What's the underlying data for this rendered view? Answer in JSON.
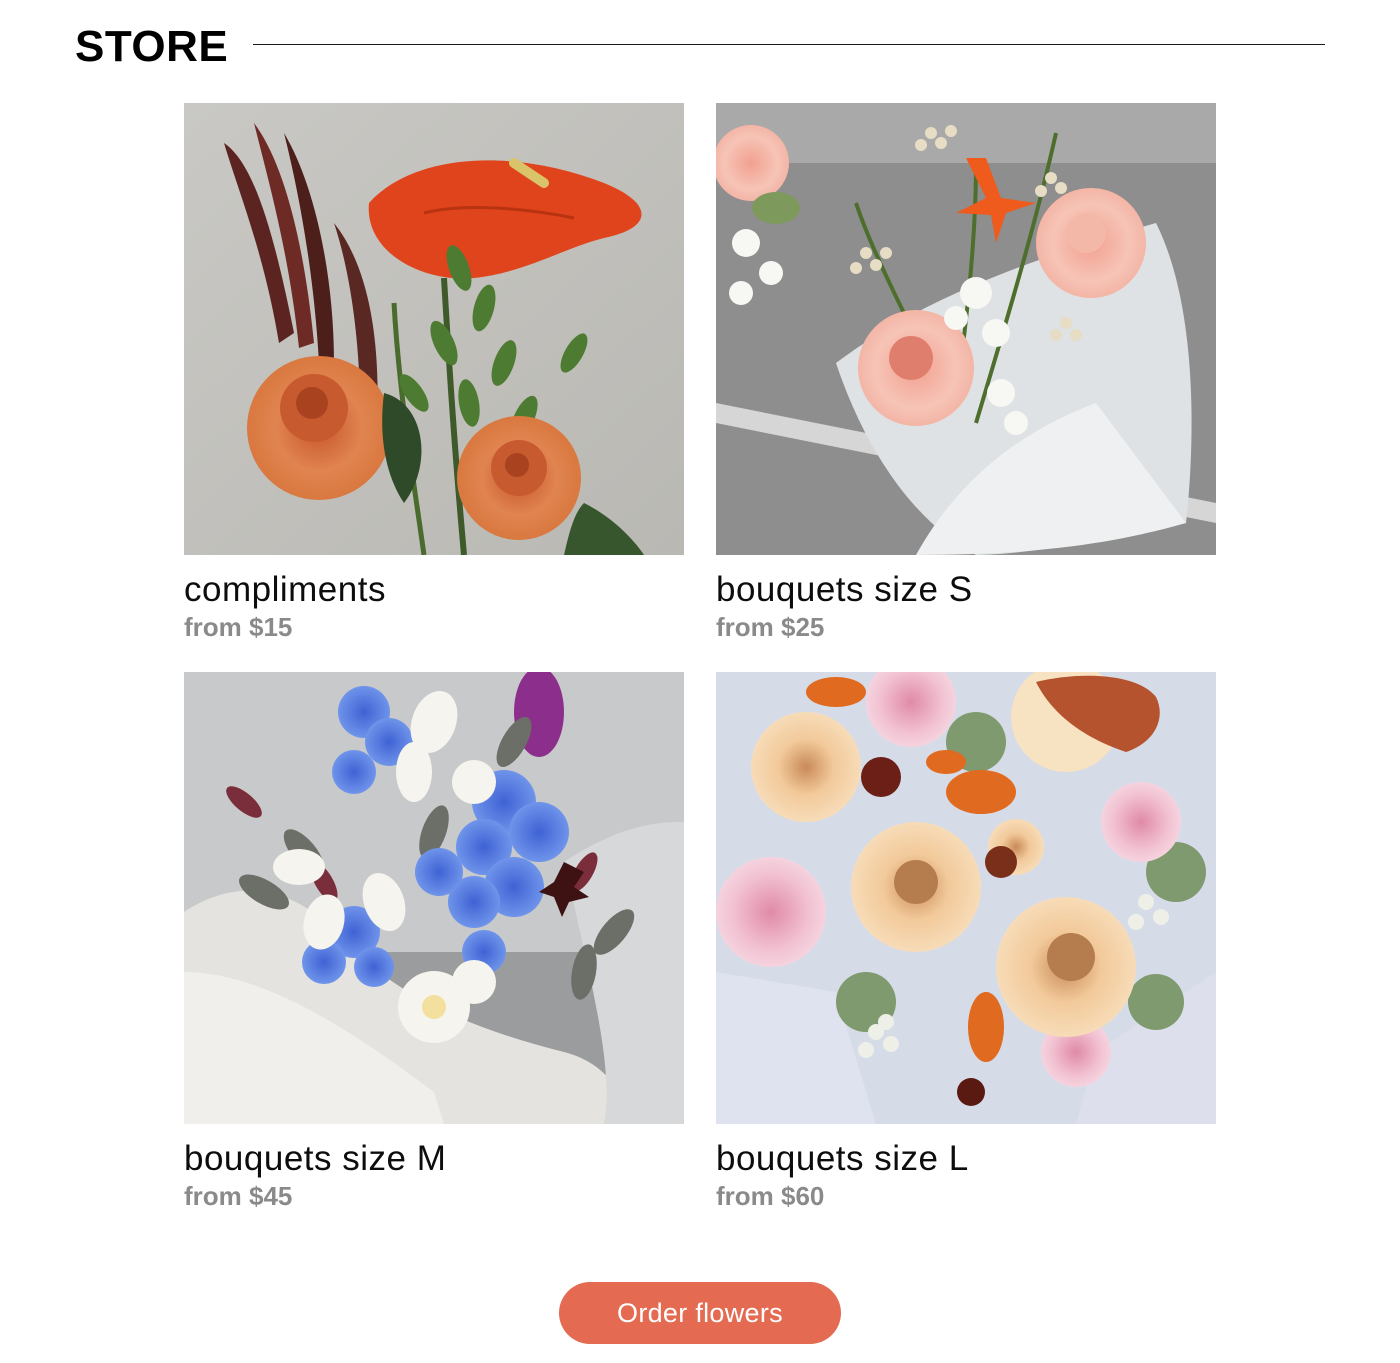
{
  "store": {
    "title": "STORE"
  },
  "products": [
    {
      "name": "compliments",
      "price": "from $15",
      "image": "orange-anthurium-rose-arrangement-photo"
    },
    {
      "name": "bouquets size S",
      "price": "from $25",
      "image": "peach-rose-bouquet-in-white-wrap-photo"
    },
    {
      "name": "bouquets size M",
      "price": "from $45",
      "image": "blue-delphinium-white-bouquet-photo"
    },
    {
      "name": "bouquets size L",
      "price": "from $60",
      "image": "peach-rose-peony-large-bouquet-photo"
    }
  ],
  "cta": {
    "label": "Order flowers"
  },
  "colors": {
    "accent": "#e46a52",
    "price_text": "#8a8a8a",
    "title_text": "#000000"
  }
}
